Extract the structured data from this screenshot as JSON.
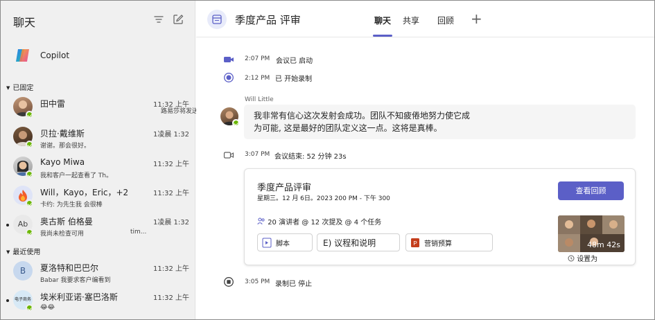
{
  "colors": {
    "accent": "#5b5fc7",
    "presence_available": "#6bb700",
    "sidebar_bg": "#f0f0f0"
  },
  "sidebar": {
    "title": "聊天",
    "copilot_label": "Copilot",
    "pinned_label": "已固定",
    "recent_label": "最近使用",
    "pinned": [
      {
        "name": "田中雷",
        "time": "11:32 上午",
        "preview": "路易莎将发送的初始列表",
        "icon": "avatar-photo"
      },
      {
        "name": "贝拉·戴维斯",
        "time": "1凌晨 1:32",
        "preview": "谢谢。那会很好。",
        "icon": "avatar-photo"
      },
      {
        "name": "Kayo Miwa",
        "time": "11:32 上午",
        "preview": "我和客户一起查看了 Th。",
        "icon": "avatar-photo"
      },
      {
        "name": "Will，Kayo，Eric，+2",
        "time": "11:32 上午",
        "preview": "卡约: 为先生我 会很棒",
        "icon": "group-fire-icon"
      },
      {
        "name": "奥古斯 伯格曼",
        "time": "1凌晨 1:32",
        "preview": "我尚未检查可用",
        "initials": "Ab",
        "extra": "tim..."
      }
    ],
    "recent": [
      {
        "name": "夏洛特和巴巴尔",
        "time": "11:32 上午",
        "preview": "Babar 我要求客户编看到",
        "initials": "B"
      },
      {
        "name": "埃米利亚诺·塞巴洛斯",
        "time": "11:32 上午",
        "preview": "😂😂",
        "avatar_text": "电子商务"
      }
    ]
  },
  "header": {
    "title": "季度产品 评审",
    "tabs": [
      "聊天",
      "共享",
      "回顾"
    ],
    "add_tab_icon": "plus-icon"
  },
  "events": [
    {
      "time": "2:07 PM",
      "text": "会议已 启动",
      "icon": "video-icon"
    },
    {
      "time": "2:12 PM",
      "text": "已 开始录制",
      "icon": "record-icon"
    },
    {
      "time": "3:07 PM",
      "text": "会议结束: 52 分钟 23s",
      "icon": "video-outline-icon"
    },
    {
      "time": "3:05 PM",
      "text": "录制已 停止",
      "icon": "stop-icon"
    }
  ],
  "message": {
    "sender": "Will Little",
    "text_line1": "我非常有信心这次发射会成功。团队不知疲倦地努力使它成",
    "text_line2": "为可能, 这是最好的团队定义这一点。这将是真棒。"
  },
  "recap_card": {
    "title": "季度产品评审",
    "subtitle": "星期三。12 月 6日。2023 200 PM - 下午 300",
    "button": "查看回顾",
    "stats": "20 演讲者 @ 12 次提及 @ 4 个任务",
    "files": [
      "脚本",
      "E) 议程和说明",
      "营销预算"
    ],
    "duration": "48m 42s",
    "caption": "设置为"
  }
}
